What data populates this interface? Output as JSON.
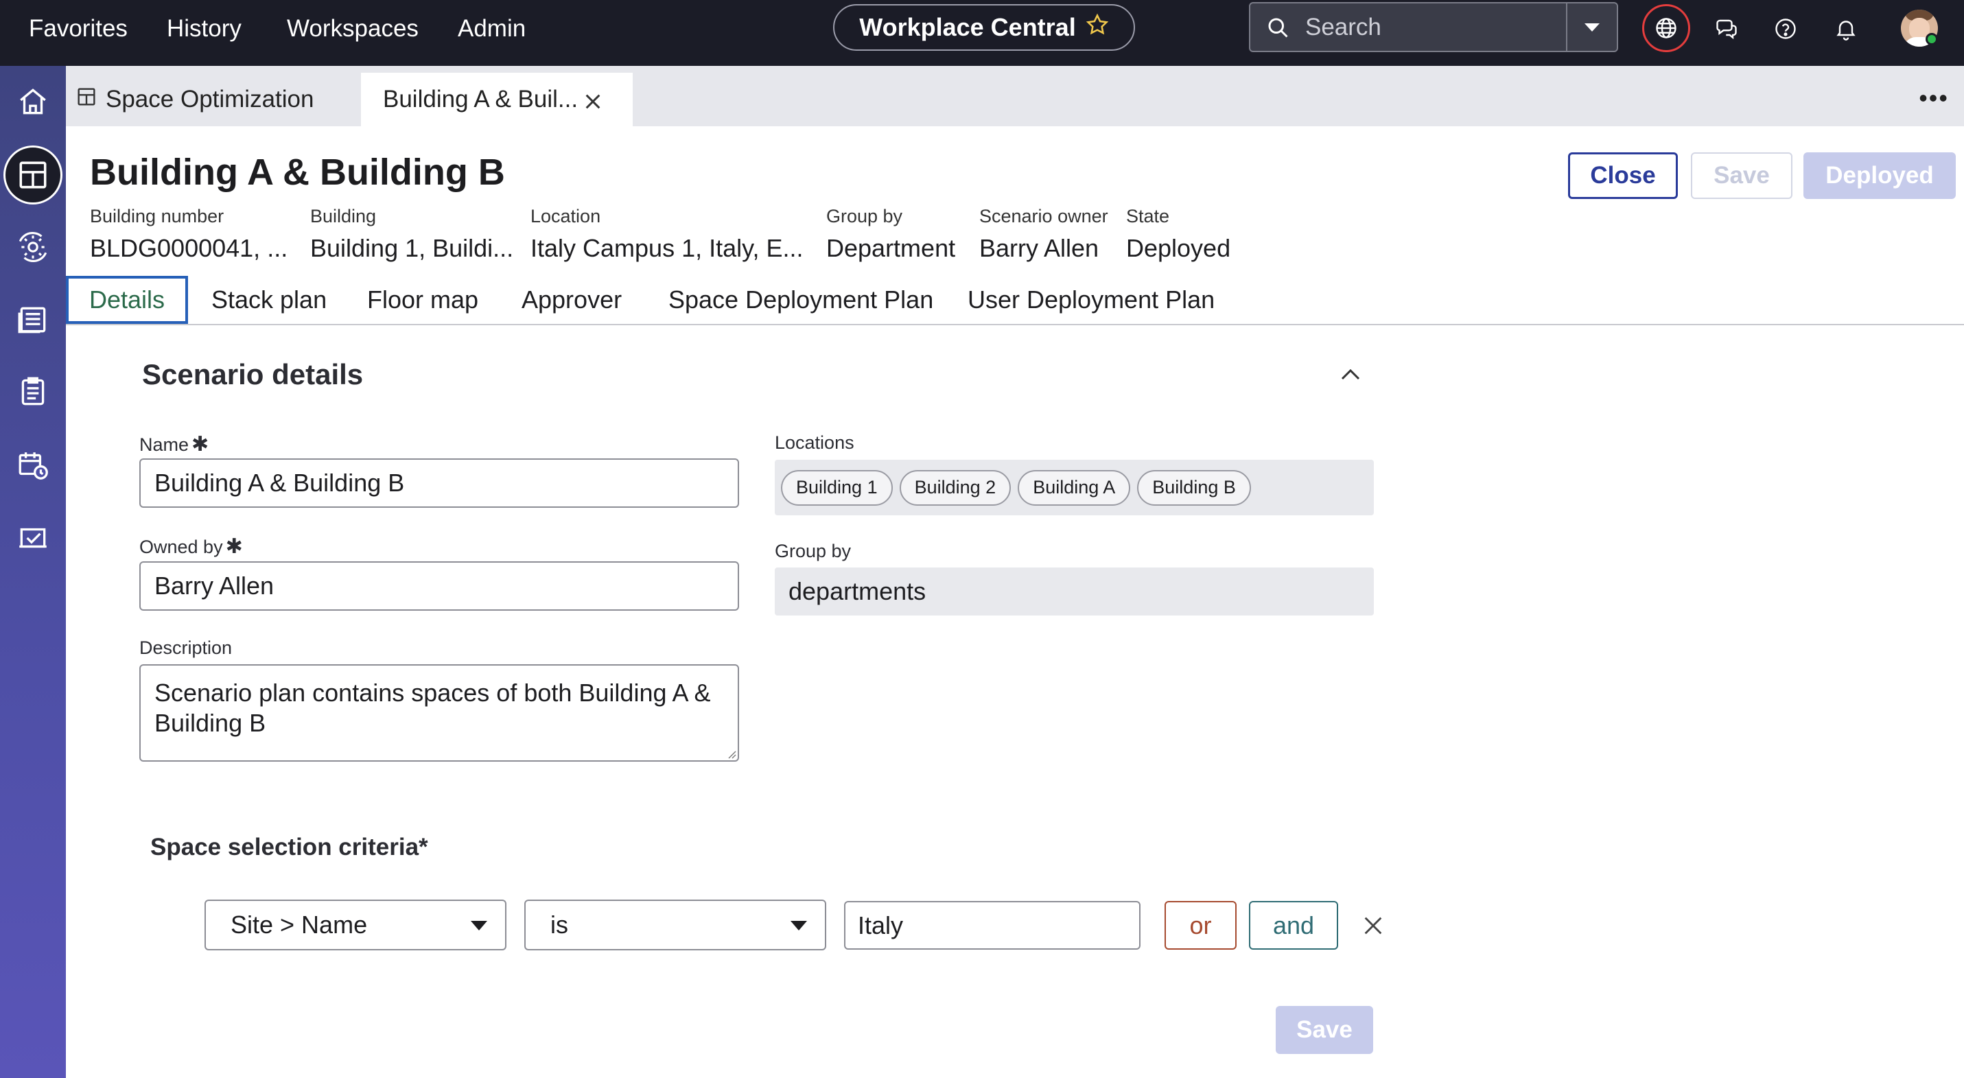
{
  "topnav": {
    "items": [
      "Favorites",
      "History",
      "Workspaces",
      "Admin"
    ],
    "app_title": "Workplace Central",
    "search_placeholder": "Search"
  },
  "tabs": {
    "tab1": "Space Optimization",
    "tab2": "Building A & Buil..."
  },
  "header": {
    "title": "Building A & Building B",
    "close_label": "Close",
    "save_label": "Save",
    "deployed_label": "Deployed"
  },
  "meta": [
    {
      "key": "Building number",
      "value": "BLDG0000041, ..."
    },
    {
      "key": "Building",
      "value": "Building 1, Buildi..."
    },
    {
      "key": "Location",
      "value": "Italy Campus 1, Italy, E..."
    },
    {
      "key": "Group by",
      "value": "Department"
    },
    {
      "key": "Scenario owner",
      "value": "Barry Allen"
    },
    {
      "key": "State",
      "value": "Deployed"
    }
  ],
  "subtabs": [
    "Details",
    "Stack plan",
    "Floor map",
    "Approver",
    "Space Deployment Plan",
    "User Deployment Plan"
  ],
  "scenario": {
    "section_title": "Scenario details",
    "name_label": "Name",
    "name_value": "Building A & Building B",
    "owned_label": "Owned by",
    "owned_value": "Barry Allen",
    "desc_label": "Description",
    "desc_value": "Scenario plan contains spaces of both Building A & Building B",
    "locations_label": "Locations",
    "locations": [
      "Building 1",
      "Building 2",
      "Building A",
      "Building B"
    ],
    "groupby_label": "Group by",
    "groupby_value": "departments",
    "required_mark": "✱"
  },
  "criteria": {
    "title": "Space selection criteria*",
    "field": "Site > Name",
    "operator": "is",
    "value": "Italy",
    "or_label": "or",
    "and_label": "and",
    "save_label": "Save"
  }
}
